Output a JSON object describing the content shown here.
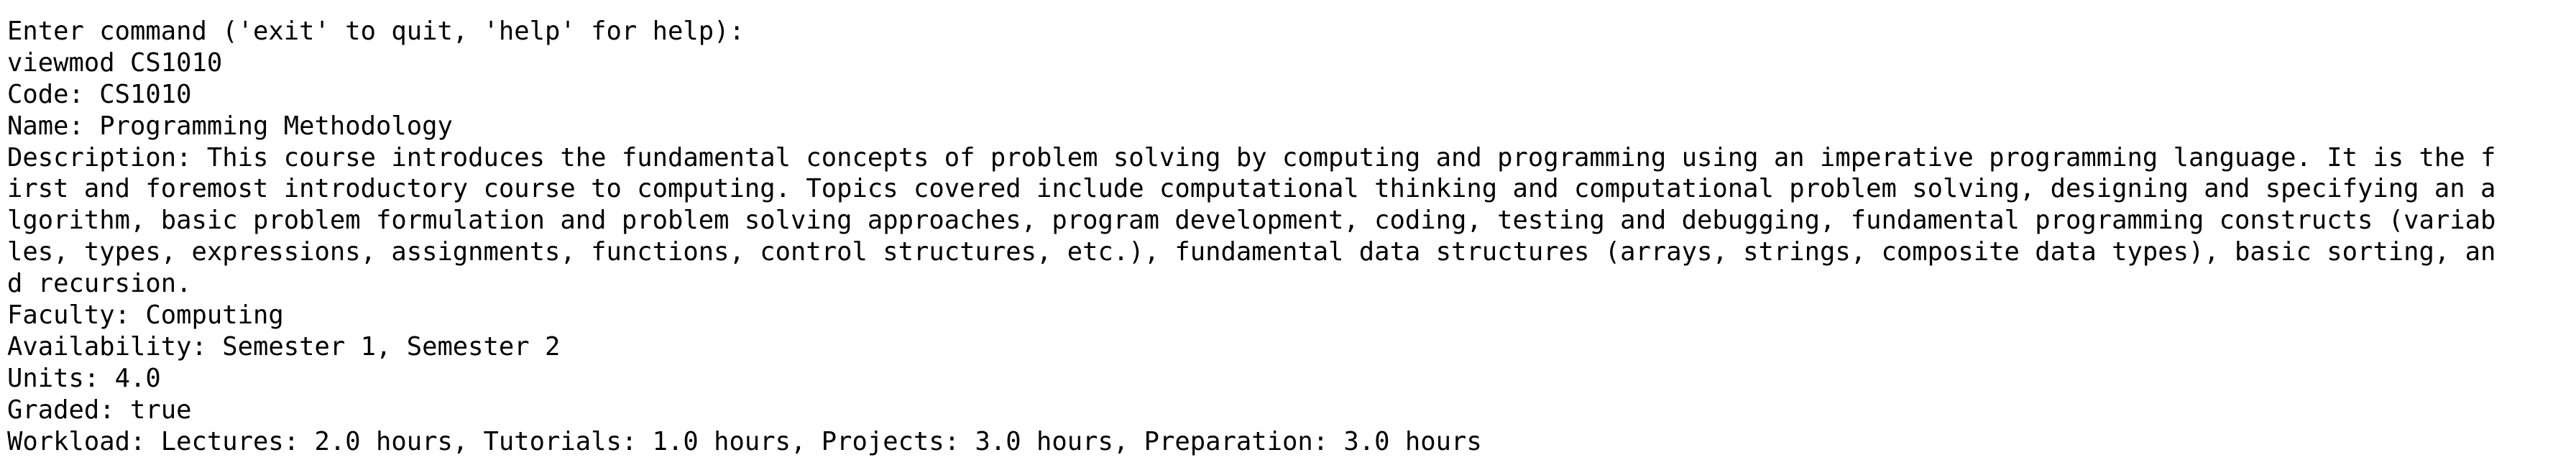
{
  "terminal": {
    "prompt": "Enter command ('exit' to quit, 'help' for help):",
    "command": "viewmod CS1010",
    "output": {
      "code_line": "Code: CS1010",
      "name_line": "Name: Programming Methodology",
      "description_lines": [
        "Description: This course introduces the fundamental concepts of problem solving by computing and programming using an imperative programming language. It is the f",
        "irst and foremost introductory course to computing. Topics covered include computational thinking and computational problem solving, designing and specifying an a",
        "lgorithm, basic problem formulation and problem solving approaches, program development, coding, testing and debugging, fundamental programming constructs (variab",
        "les, types, expressions, assignments, functions, control structures, etc.), fundamental data structures (arrays, strings, composite data types), basic sorting, an",
        "d recursion."
      ],
      "faculty_line": "Faculty: Computing",
      "availability_line": "Availability: Semester 1, Semester 2",
      "units_line": "Units: 4.0",
      "graded_line": "Graded: true",
      "workload_line": "Workload: Lectures: 2.0 hours, Tutorials: 1.0 hours, Projects: 3.0 hours, Preparation: 3.0 hours"
    }
  }
}
